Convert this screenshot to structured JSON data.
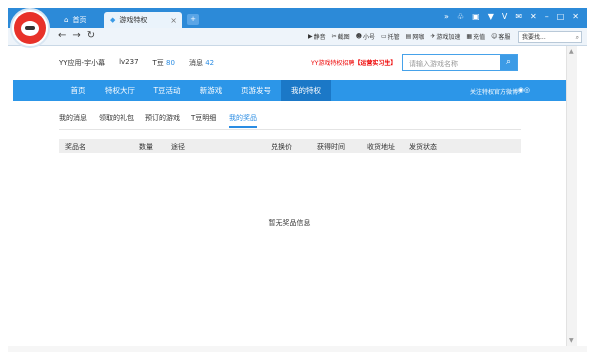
{
  "browser": {
    "tabs": [
      {
        "label": "首页"
      },
      {
        "label": "游戏特权"
      }
    ],
    "tools": [
      "静音",
      "截图",
      "小号",
      "托管",
      "网咖",
      "游戏加速",
      "充值",
      "客服"
    ],
    "search_value": "我要找..."
  },
  "user": {
    "name": "YY应用-宇小幕",
    "level": "lv237",
    "tdou_label": "T豆",
    "tdou_value": "80",
    "msg_label": "消息",
    "msg_value": "42"
  },
  "promo": {
    "text": "YY游戏特权招聘",
    "highlight": "【运营实习生】"
  },
  "game_search": {
    "placeholder": "请输入游戏名称"
  },
  "mainnav": {
    "items": [
      "首页",
      "特权大厅",
      "T豆活动",
      "新游戏",
      "页游发号",
      "我的特权"
    ],
    "follow": "关注特权官方微博:"
  },
  "subtabs": [
    "我的消息",
    "领取的礼包",
    "预订的游戏",
    "T豆明细",
    "我的奖品"
  ],
  "table": {
    "headers": [
      "奖品名",
      "数量",
      "途径",
      "兑换价",
      "获得时间",
      "收货地址",
      "发货状态"
    ]
  },
  "empty_message": "暂无奖品信息",
  "colors": {
    "nav_blue": "#2c96e8",
    "accent": "#2a8ce3",
    "promo_red": "#e00000"
  }
}
